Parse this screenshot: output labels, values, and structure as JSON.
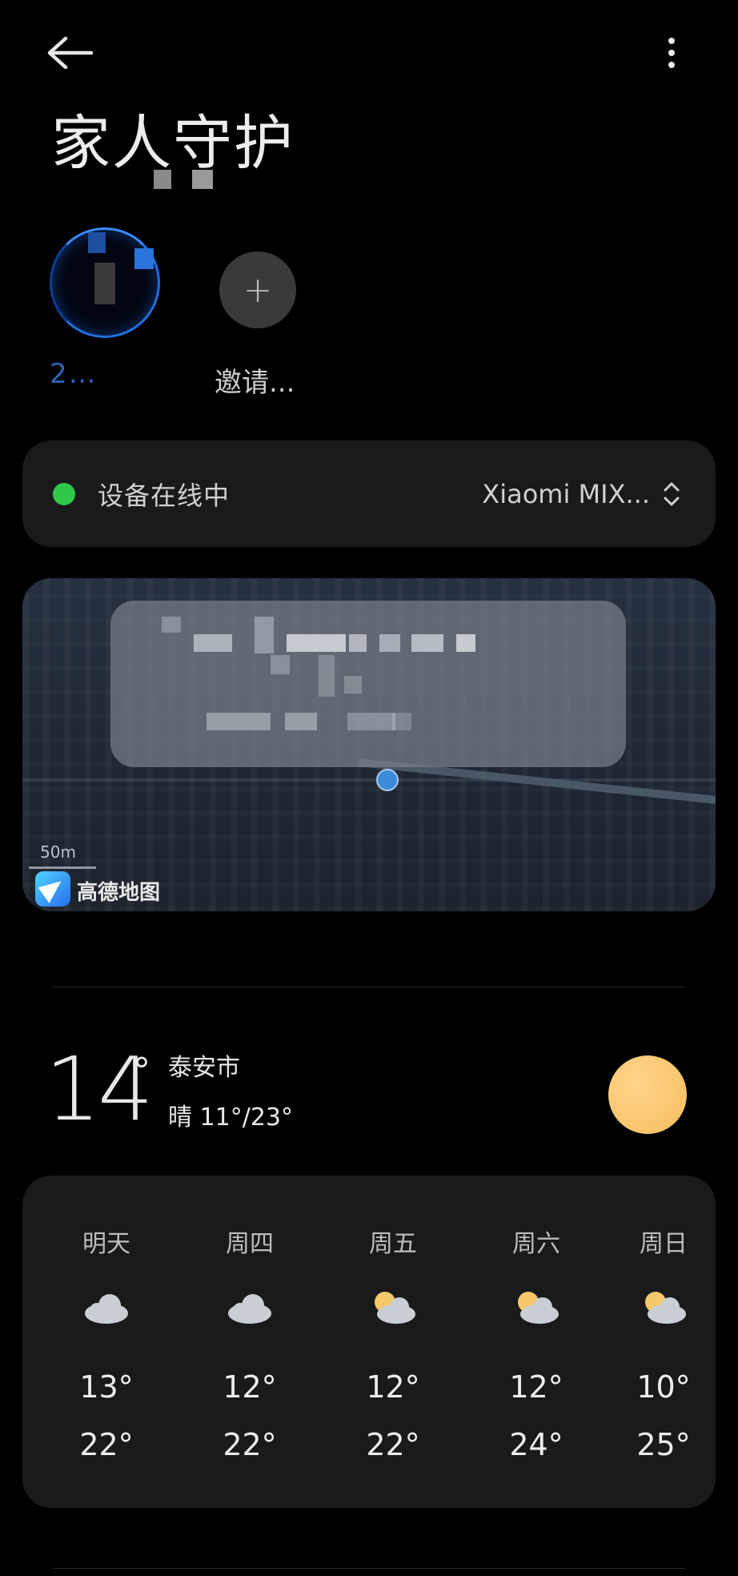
{
  "header": {
    "title": "家人守护"
  },
  "members": {
    "name": "2…",
    "invite_label": "邀请..."
  },
  "device": {
    "status_text": "设备在线中",
    "device_name": "Xiaomi MIX..."
  },
  "map": {
    "scale_label": "50m",
    "provider": "高德地图"
  },
  "weather": {
    "current_temp": "14",
    "degree_symbol": "°",
    "city": "泰安市",
    "condition_range": "晴 11°/23°",
    "forecast": [
      {
        "day": "明天",
        "icon": "cloud-icon",
        "low": "13°",
        "high": "22°"
      },
      {
        "day": "周四",
        "icon": "cloud-icon",
        "low": "12°",
        "high": "22°"
      },
      {
        "day": "周五",
        "icon": "partly-cloudy-icon",
        "low": "12°",
        "high": "22°"
      },
      {
        "day": "周六",
        "icon": "partly-cloudy-icon",
        "low": "12°",
        "high": "24°"
      },
      {
        "day": "周日",
        "icon": "partly-cloudy-icon",
        "low": "10°",
        "high": "25°"
      }
    ]
  },
  "colors": {
    "online_green": "#2fc84b",
    "accent_blue": "#1e6fe0",
    "sun": "#f8c46c"
  }
}
